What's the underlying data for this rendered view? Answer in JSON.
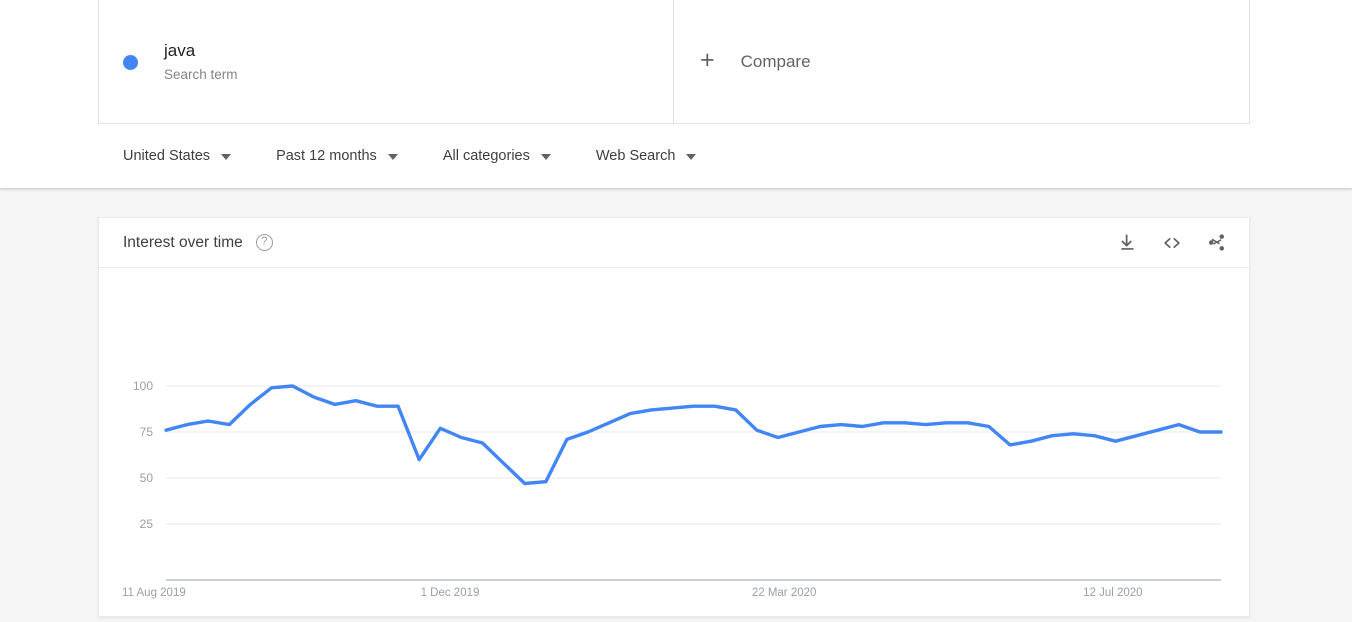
{
  "search_terms": [
    {
      "name": "java",
      "type_label": "Search term",
      "color": "#4285f4"
    }
  ],
  "compare": {
    "label": "Compare",
    "icon": "plus-icon"
  },
  "filters": [
    {
      "label": "United States",
      "name": "location"
    },
    {
      "label": "Past 12 months",
      "name": "time-range"
    },
    {
      "label": "All categories",
      "name": "category"
    },
    {
      "label": "Web Search",
      "name": "search-type"
    }
  ],
  "chart_card": {
    "title": "Interest over time",
    "help_icon": "help-icon",
    "actions": [
      {
        "name": "download-icon",
        "label": "Download"
      },
      {
        "name": "embed-icon",
        "label": "Embed"
      },
      {
        "name": "share-icon",
        "label": "Share"
      }
    ]
  },
  "chart_data": {
    "type": "line",
    "title": "Interest over time",
    "xlabel": "",
    "ylabel": "",
    "ylim": [
      0,
      100
    ],
    "yticks": [
      25,
      50,
      75,
      100
    ],
    "grid": true,
    "legend_position": "top",
    "line_color": "#4285f4",
    "xtick_labels": [
      "11 Aug 2019",
      "1 Dec 2019",
      "22 Mar 2020",
      "12 Jul 2020"
    ],
    "xtick_positions": [
      0,
      0.283,
      0.597,
      0.911
    ],
    "series": [
      {
        "name": "java",
        "values": [
          76,
          79,
          81,
          79,
          90,
          99,
          100,
          94,
          90,
          92,
          89,
          89,
          60,
          77,
          72,
          69,
          58,
          47,
          48,
          71,
          75,
          80,
          85,
          87,
          88,
          89,
          89,
          87,
          76,
          72,
          75,
          78,
          79,
          78,
          80,
          80,
          79,
          80,
          80,
          78,
          68,
          70,
          73,
          74,
          73,
          70,
          73,
          76,
          79,
          75,
          75
        ]
      }
    ]
  }
}
